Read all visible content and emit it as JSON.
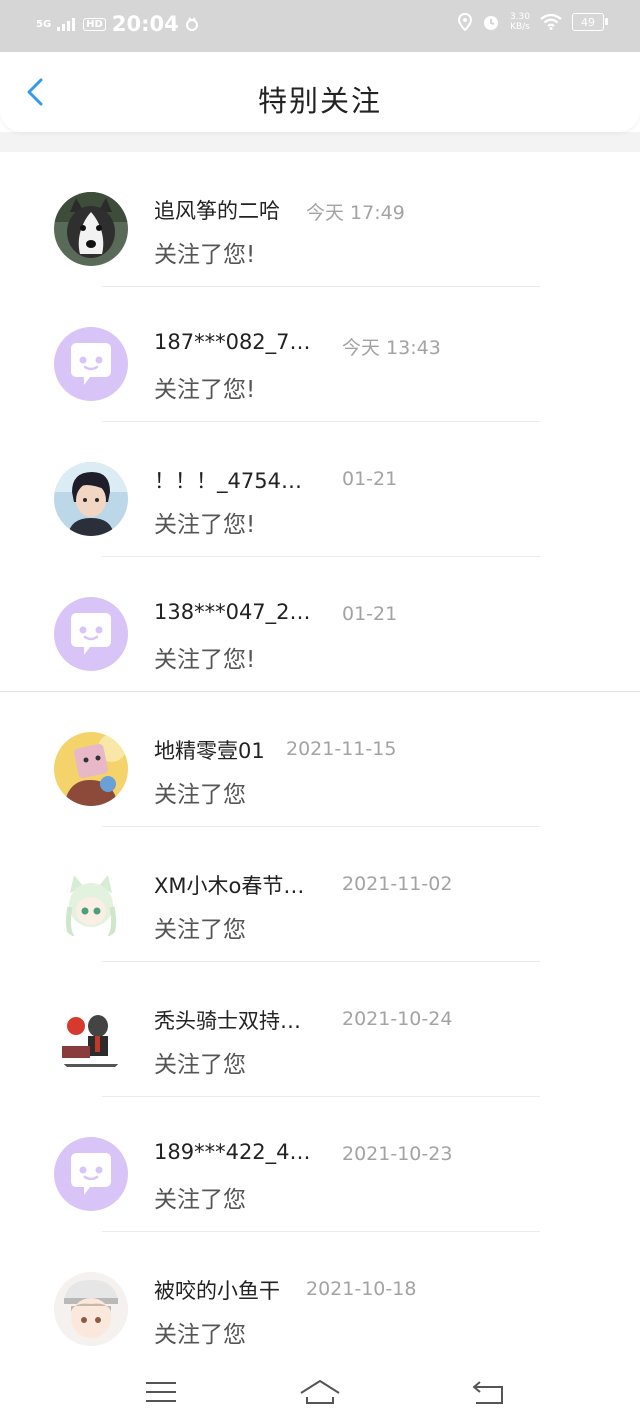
{
  "status_bar": {
    "network": "5G",
    "hd": "HD",
    "time": "20:04",
    "speed_value": "3.30",
    "speed_unit": "KB/s",
    "battery": "49"
  },
  "header": {
    "title": "特别关注"
  },
  "colors": {
    "accent": "#2f9bef",
    "avatar_default_bg": "#d8c4f6",
    "time_text": "#a3a3a3"
  },
  "items": [
    {
      "name": "追风筝的二哈",
      "time": "今天 17:49",
      "message": "关注了您!",
      "avatar": "husky-photo"
    },
    {
      "name": "187***082_7…",
      "time": "今天 13:43",
      "message": "关注了您!",
      "avatar": "default-chat-avatar"
    },
    {
      "name": "！！！_4754…",
      "time": "01-21",
      "message": "关注了您!",
      "avatar": "anime-boy"
    },
    {
      "name": "138***047_2…",
      "time": "01-21",
      "message": "关注了您!",
      "avatar": "default-chat-avatar"
    },
    {
      "name": "地精零壹01",
      "time": "2021-11-15",
      "message": "关注了您",
      "avatar": "cartoon-character"
    },
    {
      "name": "XM小木o春节…",
      "time": "2021-11-02",
      "message": "关注了您",
      "avatar": "anime-cat-girl"
    },
    {
      "name": "秃头骑士双持…",
      "time": "2021-10-24",
      "message": "关注了您",
      "avatar": "meme-sticker"
    },
    {
      "name": "189***422_4…",
      "time": "2021-10-23",
      "message": "关注了您",
      "avatar": "default-chat-avatar"
    },
    {
      "name": "被咬的小鱼干",
      "time": "2021-10-18",
      "message": "关注了您",
      "avatar": "anime-girl-hat"
    }
  ]
}
